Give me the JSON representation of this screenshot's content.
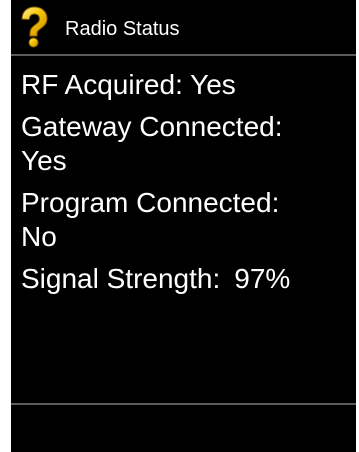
{
  "header": {
    "title": "Radio Status",
    "icon": "question-mark-icon",
    "icon_color": "#f5c400"
  },
  "status": {
    "rf_acquired": "RF Acquired: Yes",
    "gateway_label": "Gateway Connected:",
    "gateway_value": "Yes",
    "program_label": "Program Connected:",
    "program_value": "No",
    "signal_label": "Signal Strength:",
    "signal_value": "97%"
  }
}
